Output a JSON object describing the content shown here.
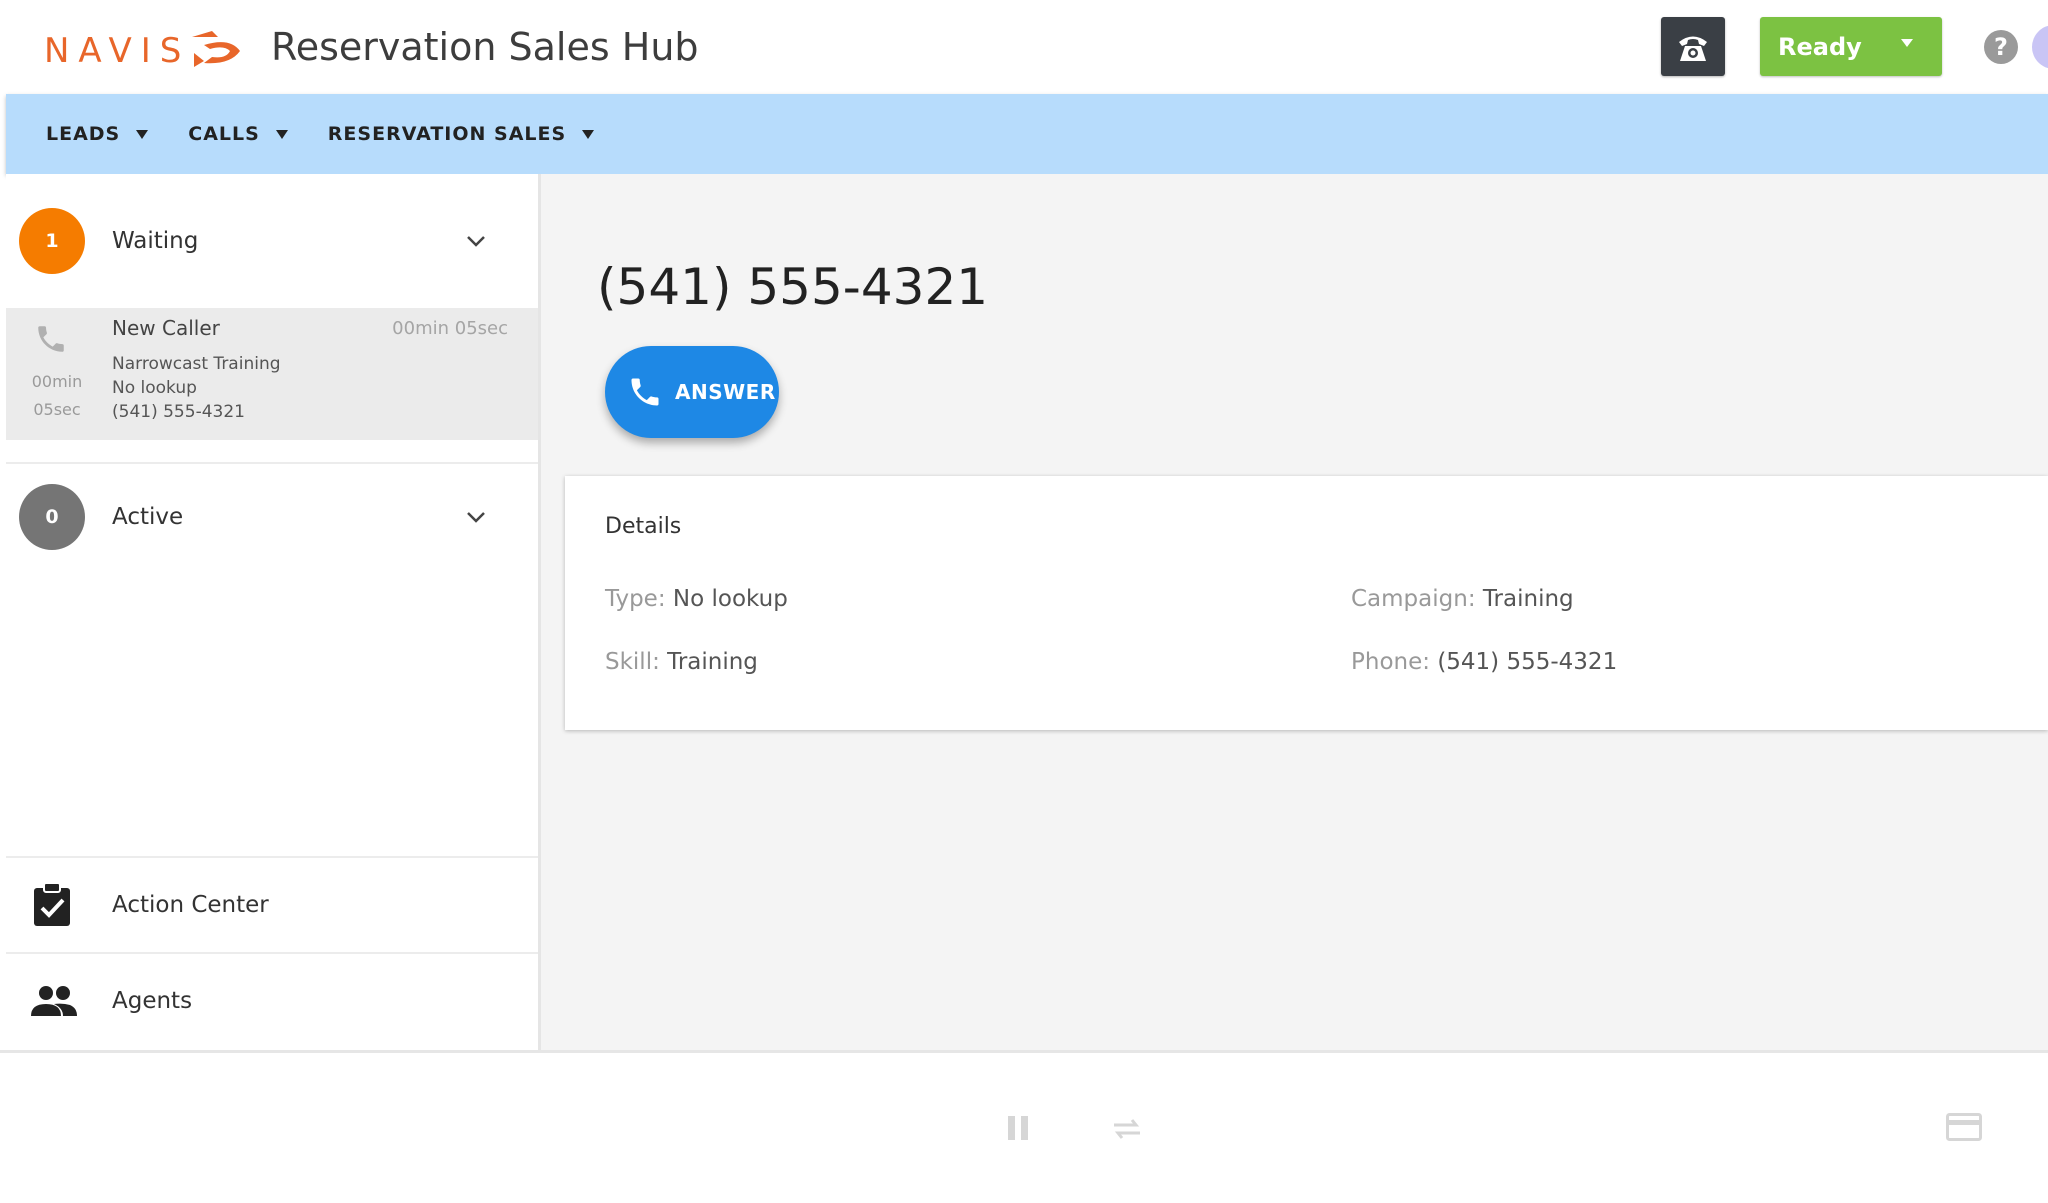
{
  "header": {
    "logo_text": "NAVIS",
    "app_title": "Reservation Sales Hub",
    "phone_icon": "telephone-icon",
    "status_button": {
      "label": "Ready",
      "color": "#7cc242"
    },
    "help_icon": "help-icon",
    "accent": "#e8662a"
  },
  "nav": {
    "items": [
      {
        "label": "LEADS"
      },
      {
        "label": "CALLS"
      },
      {
        "label": "RESERVATION SALES"
      }
    ],
    "background": "#b7dcfc"
  },
  "sidebar": {
    "waiting": {
      "count": "1",
      "label": "Waiting",
      "color": "#f57c00"
    },
    "waiting_call": {
      "name": "New Caller",
      "elapsed": "00min 05sec",
      "timer_min": "00min",
      "timer_sec": "05sec",
      "campaign_line": "Narrowcast Training",
      "type_line": "No lookup",
      "phone_line": "(541) 555-4321"
    },
    "active": {
      "count": "0",
      "label": "Active",
      "color": "#757575"
    },
    "bottom_items": [
      {
        "label": "Action Center",
        "icon": "clipboard-check-icon"
      },
      {
        "label": "Agents",
        "icon": "people-icon"
      }
    ]
  },
  "main": {
    "caller_number": "(541) 555-4321",
    "answer_label": "ANSWER",
    "answer_color": "#1e88e5",
    "details": {
      "title": "Details",
      "type_label": "Type:",
      "type_value": "No lookup",
      "campaign_label": "Campaign:",
      "campaign_value": "Training",
      "skill_label": "Skill:",
      "skill_value": "Training",
      "phone_label": "Phone:",
      "phone_value": "(541) 555-4321"
    }
  },
  "footer": {
    "icons": [
      "pause-icon",
      "transfer-icon",
      "card-icon"
    ]
  }
}
